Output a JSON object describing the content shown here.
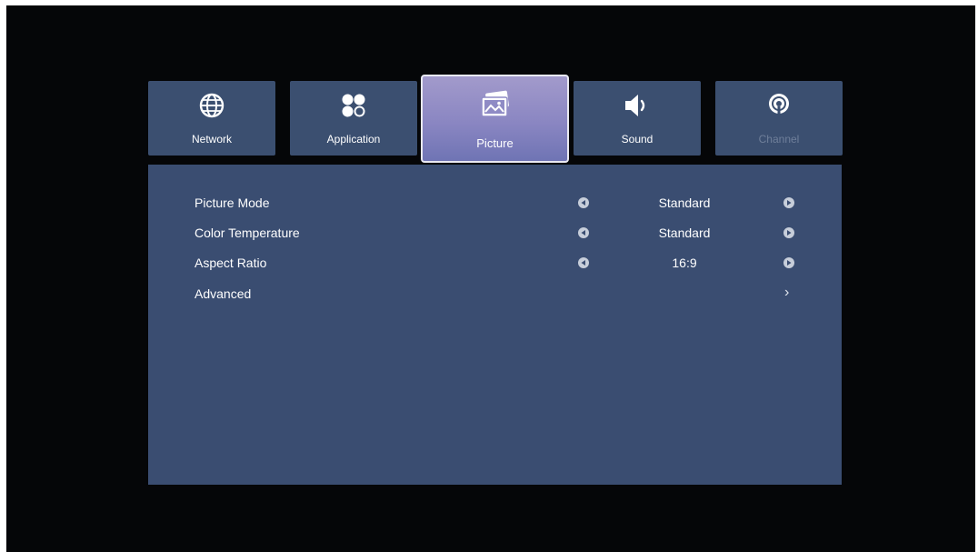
{
  "tabs": [
    {
      "label": "Network",
      "icon": "globe-icon",
      "state": "normal"
    },
    {
      "label": "Application",
      "icon": "apps-icon",
      "state": "normal"
    },
    {
      "label": "Picture",
      "icon": "picture-icon",
      "state": "active"
    },
    {
      "label": "Sound",
      "icon": "speaker-icon",
      "state": "normal"
    },
    {
      "label": "Channel",
      "icon": "channel-icon",
      "state": "disabled"
    }
  ],
  "settings": [
    {
      "label": "Picture Mode",
      "value": "Standard"
    },
    {
      "label": "Color Temperature",
      "value": "Standard"
    },
    {
      "label": "Aspect Ratio",
      "value": "16:9"
    },
    {
      "label": "Advanced",
      "value": "",
      "submenu_icon": "chevron-right-icon"
    }
  ],
  "colors": {
    "screen_bg": "#050608",
    "tab_bg": "#3b4f70",
    "active_tab_gradient": [
      "#a29acb",
      "#6f74b4"
    ],
    "panel_bg": "#3a4d71",
    "disabled_text": "#6f7f9a"
  }
}
